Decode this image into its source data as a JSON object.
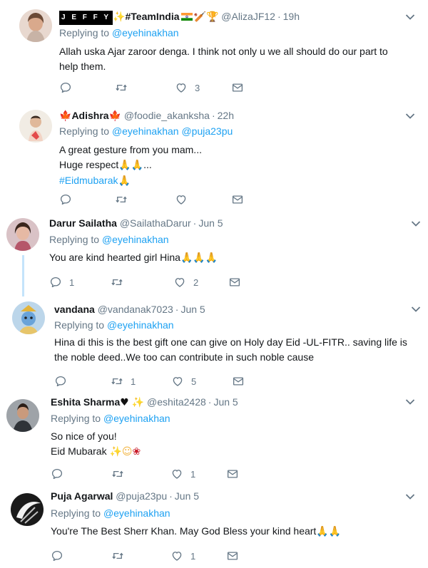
{
  "tweets": [
    {
      "name_prefix": "J E F F Y",
      "name": "#TeamIndia",
      "handle": "@AlizaJF12",
      "time": "19h",
      "reply_label": "Replying to",
      "reply_to": [
        "@eyehinakhan"
      ],
      "text": "Allah uska Ajar zaroor denga. I think not only u we all should do our part to help them.",
      "replies": "",
      "retweets": "",
      "likes": "3"
    },
    {
      "name": "Adishra",
      "handle": "@foodie_akanksha",
      "time": "22h",
      "reply_label": "Replying to",
      "reply_to": [
        "@eyehinakhan",
        "@puja23pu"
      ],
      "text_line1": "A great gesture from you mam...",
      "text_line2": "Huge respect",
      "text_line2_suffix": "...",
      "hashtag": "#Eidmubarak",
      "replies": "",
      "retweets": "",
      "likes": ""
    },
    {
      "name": "Darur Sailatha",
      "handle": "@SailathaDarur",
      "time": "Jun 5",
      "reply_label": "Replying to",
      "reply_to": [
        "@eyehinakhan"
      ],
      "text": "You are kind hearted girl Hina",
      "replies": "1",
      "retweets": "",
      "likes": "2"
    },
    {
      "name": "vandana",
      "handle": "@vandanak7023",
      "time": "Jun 5",
      "reply_label": "Replying to",
      "reply_to": [
        "@eyehinakhan"
      ],
      "text": "Hina di this is the best gift one can give on Holy day Eid -UL-FITR.. saving life is the noble deed..We too can contribute in such noble cause",
      "replies": "",
      "retweets": "1",
      "likes": "5"
    },
    {
      "name": "Eshita Sharma",
      "handle": "@eshita2428",
      "time": "Jun 5",
      "reply_label": "Replying to",
      "reply_to": [
        "@eyehinakhan"
      ],
      "text_line1": "So nice of you!",
      "text_line2": "Eid Mubarak",
      "replies": "",
      "retweets": "",
      "likes": "1"
    },
    {
      "name": "Puja Agarwal",
      "handle": "@puja23pu",
      "time": "Jun 5",
      "reply_label": "Replying to",
      "reply_to": [
        "@eyehinakhan"
      ],
      "text": "You're The Best Sherr Khan. May God Bless your kind heart",
      "replies": "",
      "retweets": "",
      "likes": "1"
    }
  ],
  "icons": {
    "reply": "reply-icon",
    "retweet": "retweet-icon",
    "like": "heart-icon",
    "dm": "mail-icon",
    "more": "chevron-down-icon"
  },
  "colors": {
    "link": "#1da1f2",
    "secondary": "#657786",
    "icon": "#657786",
    "divider": "#e6ecf0",
    "thread_line": "#c4e4fb"
  }
}
